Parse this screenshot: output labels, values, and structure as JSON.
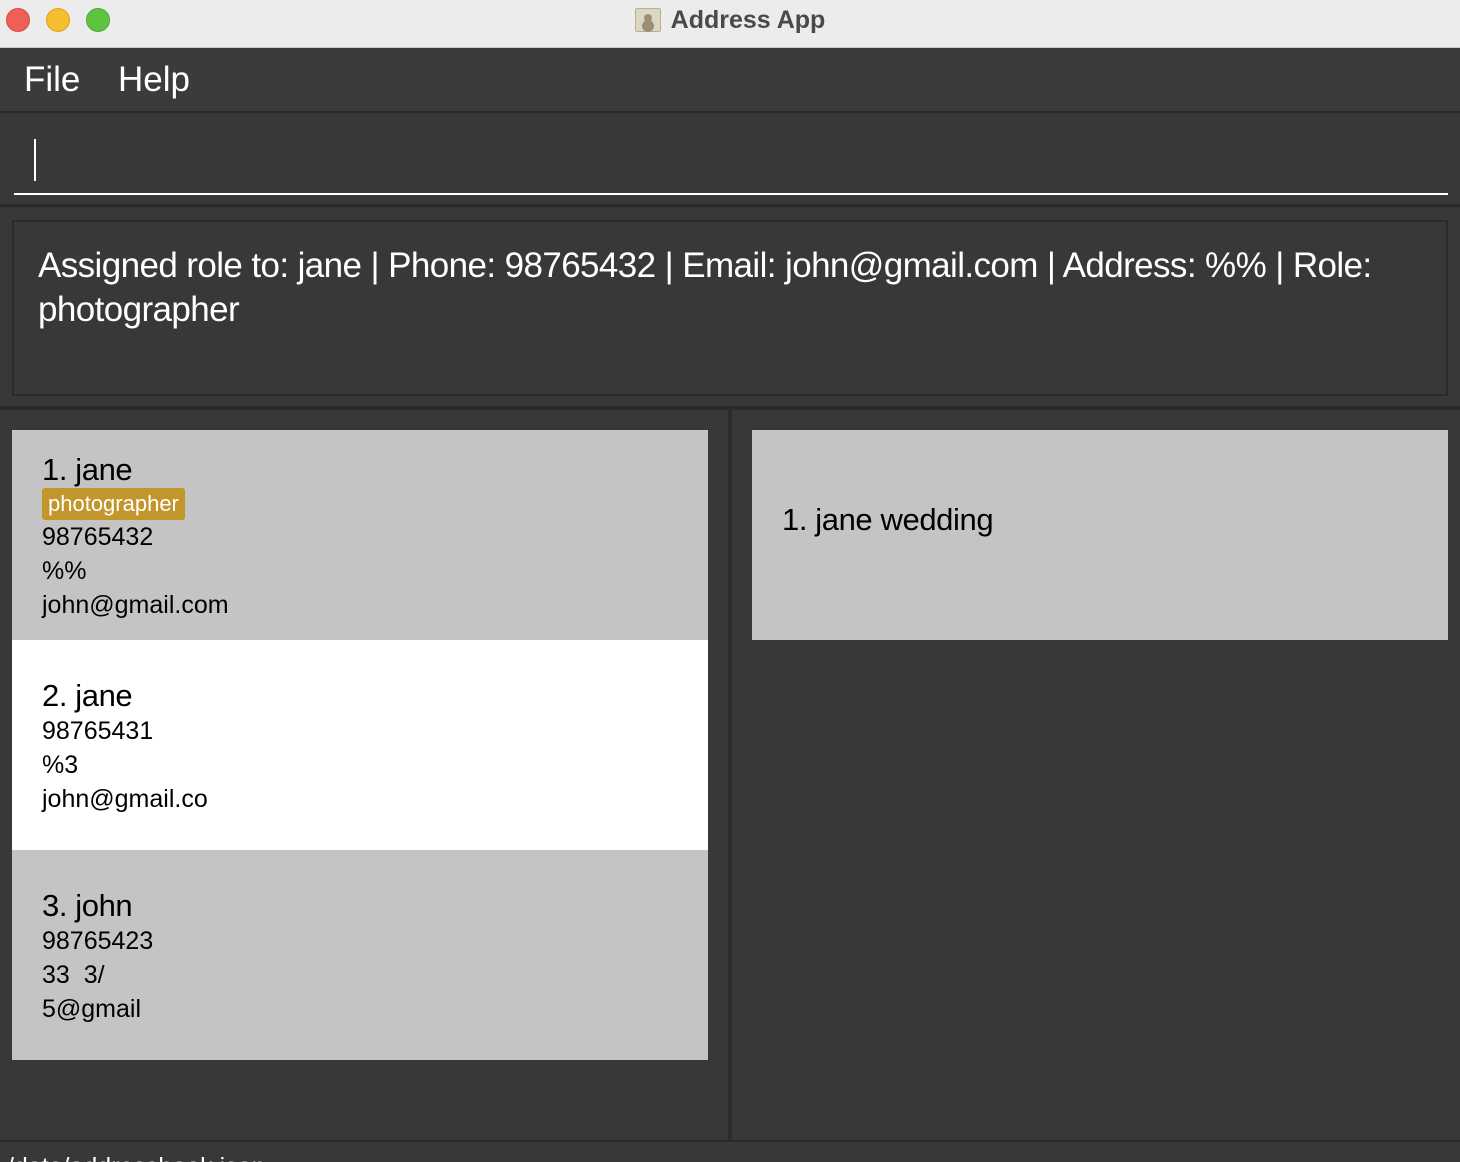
{
  "window": {
    "title": "Address App"
  },
  "menu": {
    "file": "File",
    "help": "Help"
  },
  "command": {
    "value": "",
    "placeholder": ""
  },
  "result": {
    "text": "Assigned role to: jane | Phone: 98765432 | Email: john@gmail.com | Address: %% | Role: photographer"
  },
  "persons": [
    {
      "name": "1. jane",
      "role": "photographer",
      "phone": "98765432",
      "address": "%%",
      "email": "john@gmail.com"
    },
    {
      "name": "2. jane",
      "phone": "98765431",
      "address": "%3",
      "email": "john@gmail.co"
    },
    {
      "name": "3. john",
      "phone": "98765423",
      "address": "33  3/",
      "email": "5@gmail"
    }
  ],
  "events": [
    {
      "name": "1. jane wedding"
    }
  ],
  "status": {
    "path": "./data/addressbook.json"
  },
  "colors": {
    "role_tag": "#c3962c",
    "card_alt": "#c4c4c4",
    "card_selected": "#ffffff",
    "background": "#383838"
  }
}
